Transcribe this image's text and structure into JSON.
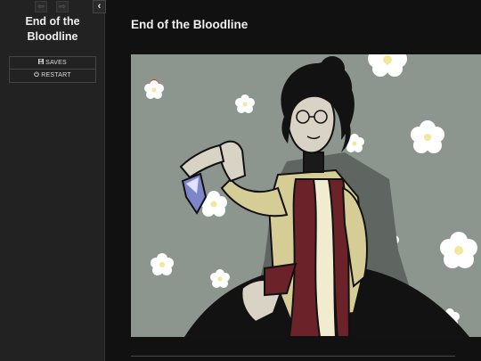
{
  "sidebar": {
    "title": "End of the Bloodline",
    "back_label": "⇦",
    "forward_label": "⇨",
    "toggle_label": "‹",
    "menu": {
      "saves_label": "SAVES",
      "restart_label": "RESTART"
    }
  },
  "passage": {
    "title": "End of the Bloodline",
    "illustration_subject": "woman-holding-crystal-flowers"
  },
  "colors": {
    "sidebar_bg": "#222222",
    "page_bg": "#111111",
    "illustration_bg": "#8d958f",
    "text": "#eeeeee"
  }
}
